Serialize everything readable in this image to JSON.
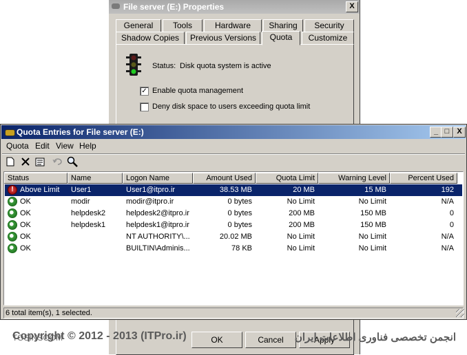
{
  "props": {
    "title": "File server (E:) Properties",
    "close": "X",
    "tabs_row1": [
      "General",
      "Tools",
      "Hardware",
      "Sharing",
      "Security"
    ],
    "tabs_row2": [
      "Shadow Copies",
      "Previous Versions",
      "Quota",
      "Customize"
    ],
    "status_label": "Status:",
    "status_value": "Disk quota system is active",
    "enable_label": "Enable quota management",
    "enable_checked": "✓",
    "deny_label": "Deny disk space to users exceeding quota limit",
    "bottom_buttons": [
      "OK",
      "Cancel",
      "Apply"
    ]
  },
  "quota": {
    "title": "Quota Entries for File server (E:)",
    "window_buttons": [
      "_",
      "□",
      "X"
    ],
    "menu": [
      "Quota",
      "Edit",
      "View",
      "Help"
    ],
    "toolbar_icons": [
      "new-icon",
      "delete-icon",
      "properties-icon",
      "undo-icon",
      "find-icon"
    ],
    "columns": [
      "Status",
      "Name",
      "Logon Name",
      "Amount Used",
      "Quota Limit",
      "Warning Level",
      "Percent Used"
    ],
    "rows": [
      {
        "status": "Above Limit",
        "name": "User1",
        "logon": "User1@itpro.ir",
        "used": "38.53 MB",
        "limit": "20 MB",
        "warning": "15 MB",
        "percent": "192",
        "icon": "warn"
      },
      {
        "status": "OK",
        "name": "modir",
        "logon": "modir@itpro.ir",
        "used": "0 bytes",
        "limit": "No Limit",
        "warning": "No Limit",
        "percent": "N/A",
        "icon": "ok"
      },
      {
        "status": "OK",
        "name": "helpdesk2",
        "logon": "helpdesk2@itpro.ir",
        "used": "0 bytes",
        "limit": "200 MB",
        "warning": "150 MB",
        "percent": "0",
        "icon": "ok"
      },
      {
        "status": "OK",
        "name": "helpdesk1",
        "logon": "helpdesk1@itpro.ir",
        "used": "0 bytes",
        "limit": "200 MB",
        "warning": "150 MB",
        "percent": "0",
        "icon": "ok"
      },
      {
        "status": "OK",
        "name": "",
        "logon": "NT AUTHORITY\\...",
        "used": "20.02 MB",
        "limit": "No Limit",
        "warning": "No Limit",
        "percent": "N/A",
        "icon": "ok"
      },
      {
        "status": "OK",
        "name": "",
        "logon": "BUILTIN\\Adminis...",
        "used": "78 KB",
        "limit": "No Limit",
        "warning": "No Limit",
        "percent": "N/A",
        "icon": "ok"
      }
    ],
    "status_bar": "6 total item(s), 1 selected."
  },
  "watermark": {
    "left": "TOSINSOOM",
    "copyright": "Copyright © 2012 - 2013 (ITPro.ir)",
    "persian": "انجمن تخصصی فناوری اطلاعات ایران"
  },
  "colors": {
    "selection": "#0a246a",
    "dialog_bg": "#d4d0c8",
    "title_gradient_start": "#0a246a"
  }
}
